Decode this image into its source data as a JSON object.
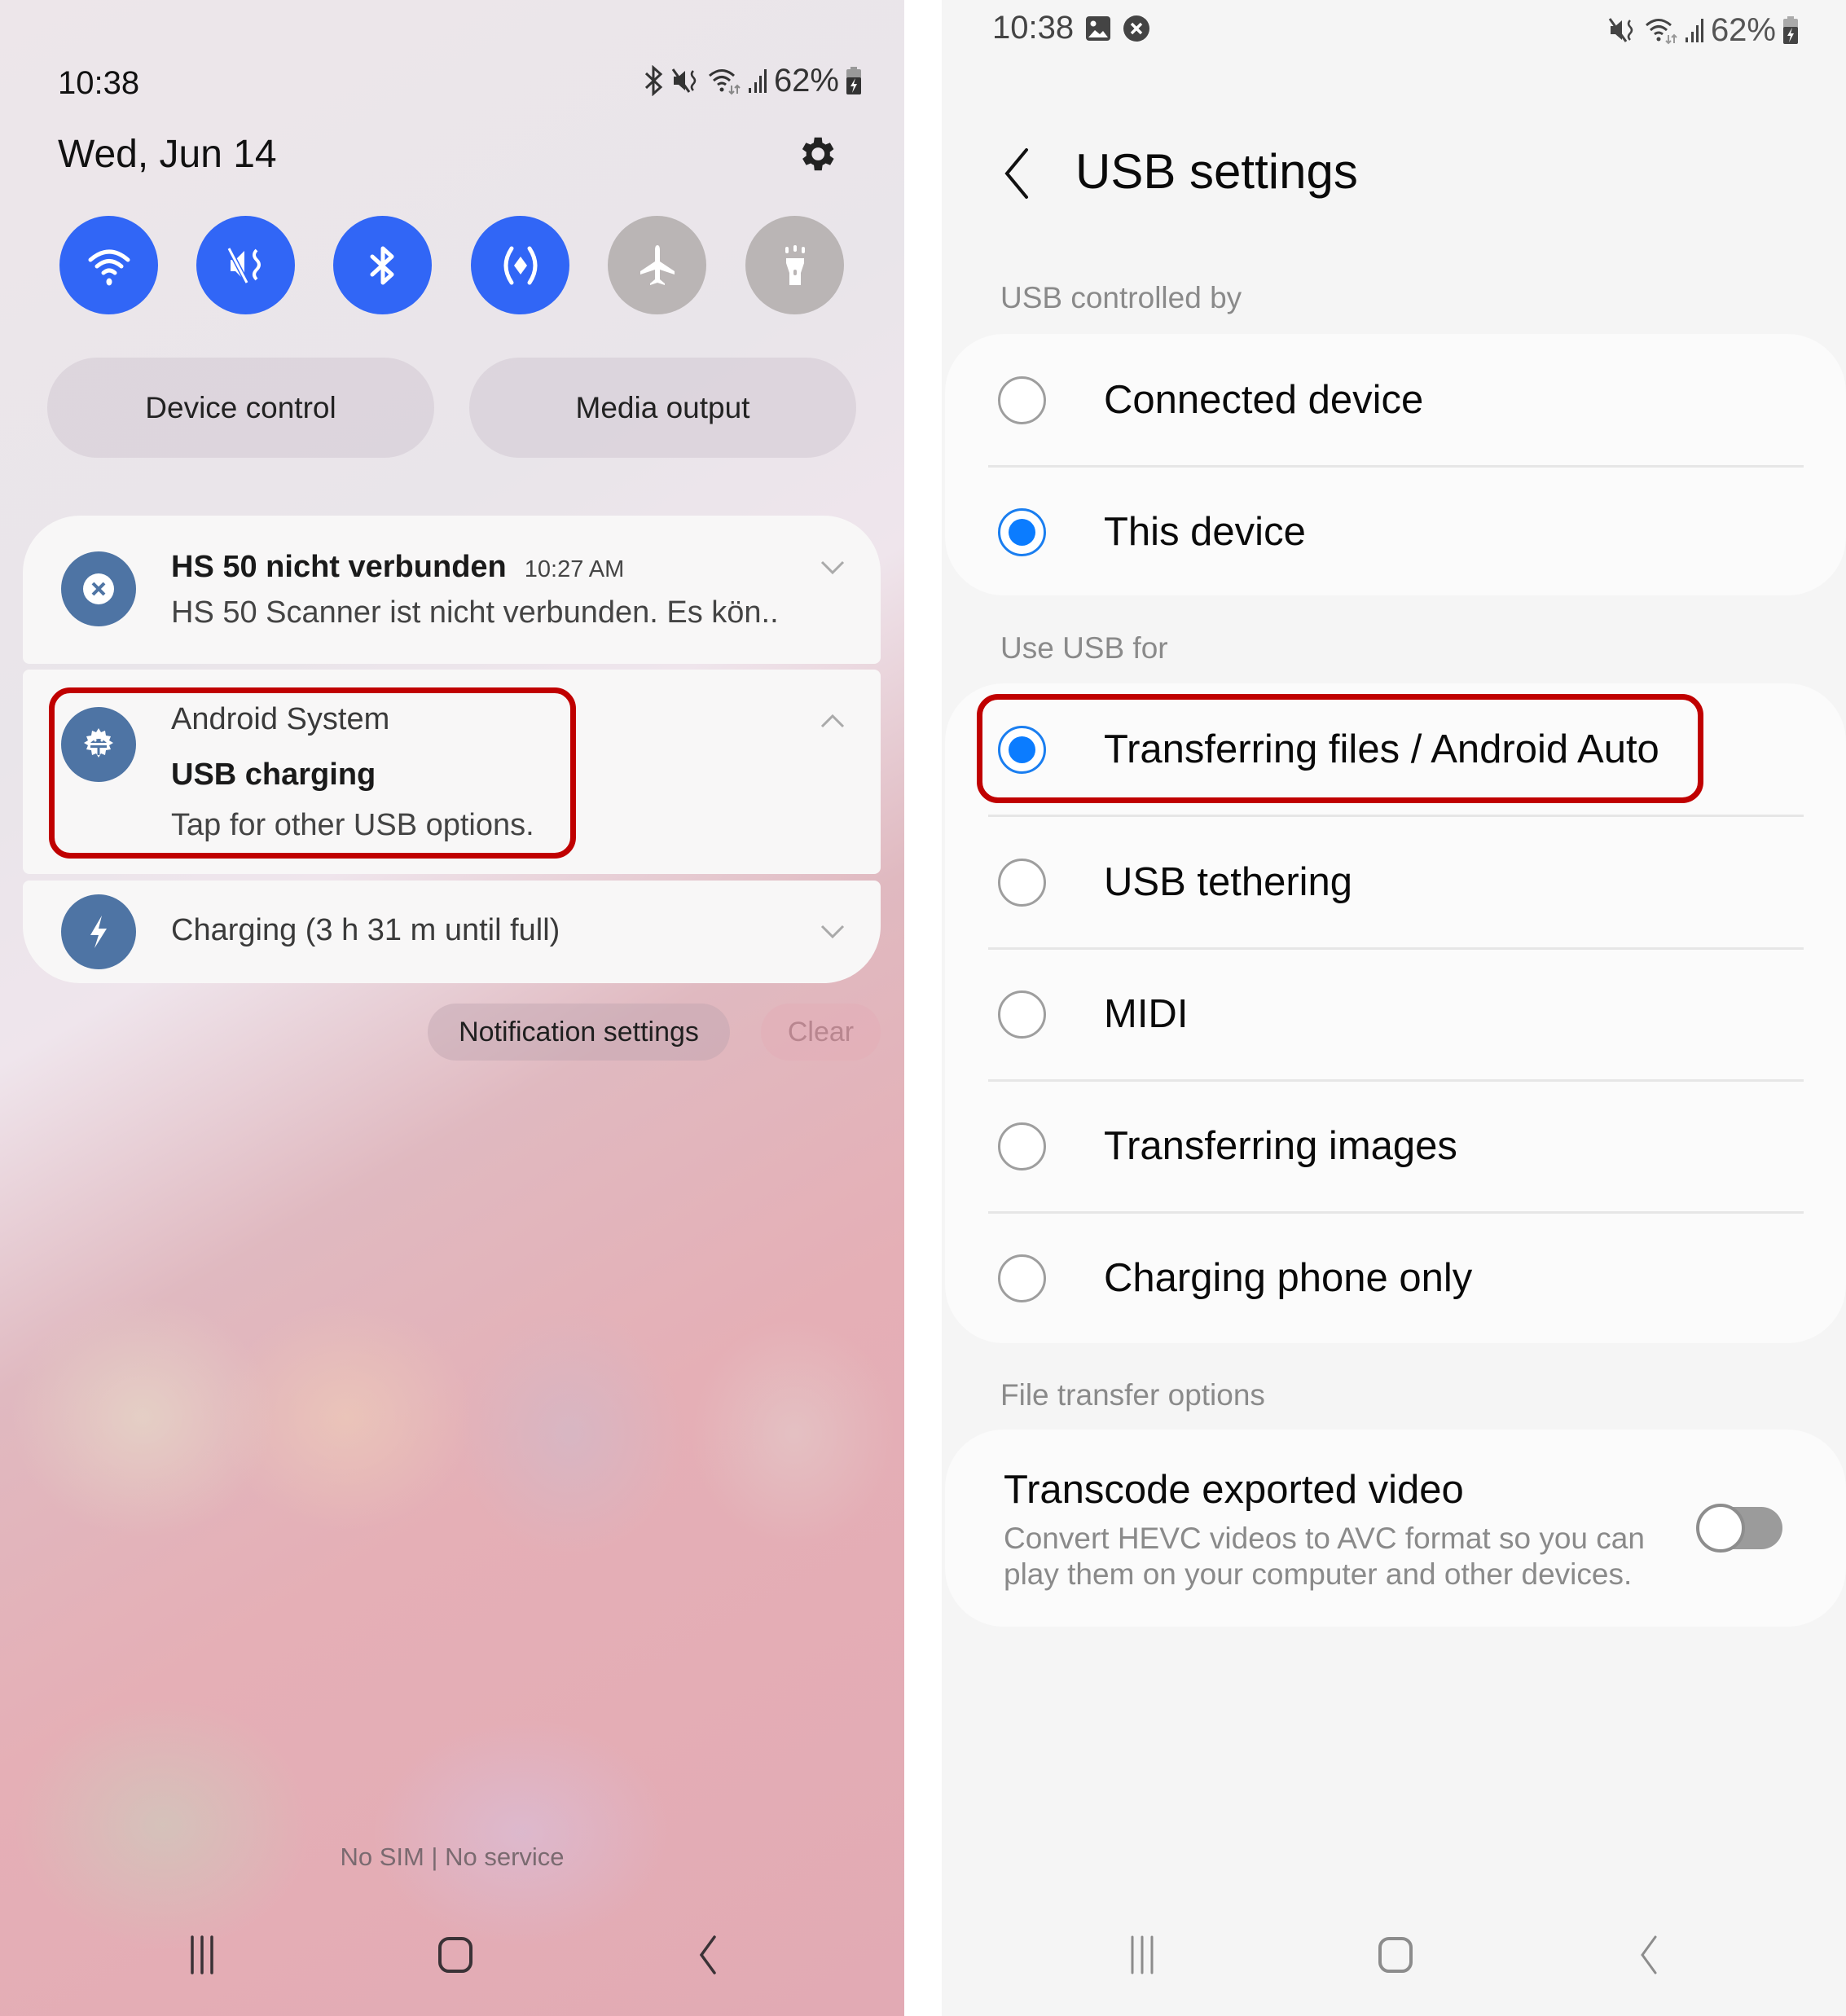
{
  "left_panel": {
    "status_bar": {
      "time": "10:38",
      "battery": "62%",
      "icons": [
        "bluetooth-icon",
        "mute-vibrate-icon",
        "wifi-icon",
        "signal-icon",
        "battery-charging-icon"
      ]
    },
    "date": "Wed, Jun 14",
    "settings_icon": "gear-icon",
    "quick_toggles": [
      {
        "name": "wifi",
        "icon": "wifi-icon",
        "active": true
      },
      {
        "name": "sound",
        "icon": "mute-vibrate-icon",
        "active": true
      },
      {
        "name": "bluetooth",
        "icon": "bluetooth-icon",
        "active": true
      },
      {
        "name": "auto-rotate",
        "icon": "rotate-icon",
        "active": true
      },
      {
        "name": "airplane-mode",
        "icon": "airplane-icon",
        "active": false
      },
      {
        "name": "flashlight",
        "icon": "flashlight-icon",
        "active": false
      }
    ],
    "buttons": {
      "device_control": "Device control",
      "media_output": "Media output"
    },
    "notifications": [
      {
        "title": "HS 50 nicht verbunden",
        "time": "10:27 AM",
        "body": "HS 50 Scanner ist nicht verbunden. Es kön..",
        "icon": "close-icon",
        "expanded": false
      },
      {
        "app": "Android System",
        "title": "USB charging",
        "body": "Tap for other USB options.",
        "icon": "android-system-gear-icon",
        "expanded": true,
        "highlighted": true
      },
      {
        "title": "Charging (3 h 31 m until full)",
        "icon": "lightning-icon",
        "expanded": false
      }
    ],
    "notification_settings": "Notification settings",
    "clear": "Clear",
    "carrier_text": "No SIM | No service",
    "nav": [
      "recents-icon",
      "home-icon",
      "back-icon"
    ]
  },
  "right_panel": {
    "status_bar": {
      "time": "10:38",
      "battery": "62%",
      "left_icons": [
        "image-icon",
        "close-circle-icon"
      ],
      "right_icons": [
        "mute-vibrate-icon",
        "wifi-icon",
        "signal-icon",
        "battery-charging-icon"
      ]
    },
    "title": "USB settings",
    "sections": [
      {
        "label": "USB controlled by",
        "options": [
          {
            "label": "Connected device",
            "selected": false
          },
          {
            "label": "This device",
            "selected": true
          }
        ]
      },
      {
        "label": "Use USB for",
        "options": [
          {
            "label": "Transferring files / Android Auto",
            "selected": true,
            "highlighted": true
          },
          {
            "label": "USB tethering",
            "selected": false
          },
          {
            "label": "MIDI",
            "selected": false
          },
          {
            "label": "Transferring images",
            "selected": false
          },
          {
            "label": "Charging phone only",
            "selected": false
          }
        ]
      },
      {
        "label": "File transfer options",
        "switch": {
          "title": "Transcode exported video",
          "description": "Convert HEVC videos to AVC format so you can play them on your computer and other devices.",
          "on": false
        }
      }
    ],
    "nav": [
      "recents-icon",
      "home-icon",
      "back-icon"
    ]
  },
  "colors": {
    "toggle_active": "#3166f6",
    "toggle_inactive": "#bab5b5",
    "radio_selected": "#0b7cff",
    "notification_icon_bg": "#4e74a4",
    "highlight_box": "#c00000"
  }
}
